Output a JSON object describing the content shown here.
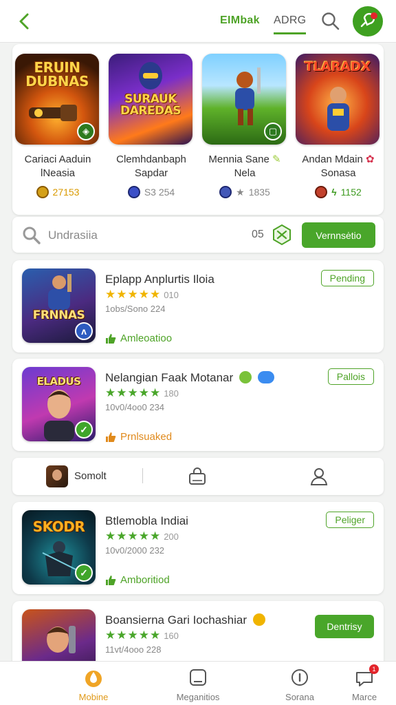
{
  "header": {
    "tab_a": "EIMbak",
    "tab_b": "ADRG"
  },
  "featured": [
    {
      "art": "ERUIN DUBNAS",
      "name_line1": "Cariaci Aaduin",
      "name_line2": "lNeasia",
      "meta": "27153",
      "meta_color": "#d99a00"
    },
    {
      "art": "SURAUK DAREDAS",
      "name_line1": "Clemhdanbaph",
      "name_line2": "Sapdar",
      "meta": "S3 254",
      "meta_color": "#888888"
    },
    {
      "art": "",
      "name_line1": "Mennia Sane",
      "name_line2": "Nela",
      "meta": "1835",
      "meta_color": "#888888"
    },
    {
      "art": "TLARADX",
      "name_line1": "Andan Mdain",
      "name_line2": "Sonasa",
      "meta": "1152",
      "meta_color": "#3c9a1f"
    }
  ],
  "search": {
    "placeholder": "Undrasiia",
    "count": "05",
    "button": "Vernnsėtio"
  },
  "cards": [
    {
      "art": "FRNNAS",
      "title": "Eplapp Anplurtis Iloia",
      "stars": "★★★★★",
      "rating": "010",
      "sub": "1obs/Sono 224",
      "status": "Amleoatioo",
      "pill": "Pending"
    },
    {
      "art": "ELADUS",
      "title": "Nelangian Faak Motanar",
      "stars": "★★★★★",
      "rating": "180",
      "sub": "10v0/4oo0 234",
      "status": "Prnlsuaked",
      "pill": "Pallois"
    },
    {
      "art": "SKODR",
      "title": "Btlemobla Indiai",
      "stars": "★★★★★",
      "rating": "200",
      "sub": "10v0/2000 232",
      "status": "Amboritiod",
      "pill": "Peliger"
    },
    {
      "art": "",
      "title": "Boansierna Gari Iochashiar",
      "stars": "★★★★★",
      "rating": "160",
      "sub": "11vt/4ooo 228",
      "status": "",
      "pill": "Dentrisy"
    }
  ],
  "midbar": {
    "label": "Somolt"
  },
  "bottom_nav": [
    {
      "label": "Mobine"
    },
    {
      "label": "Meganitios"
    },
    {
      "label": "Sorana"
    },
    {
      "label": "Marce",
      "badge": "1"
    }
  ]
}
